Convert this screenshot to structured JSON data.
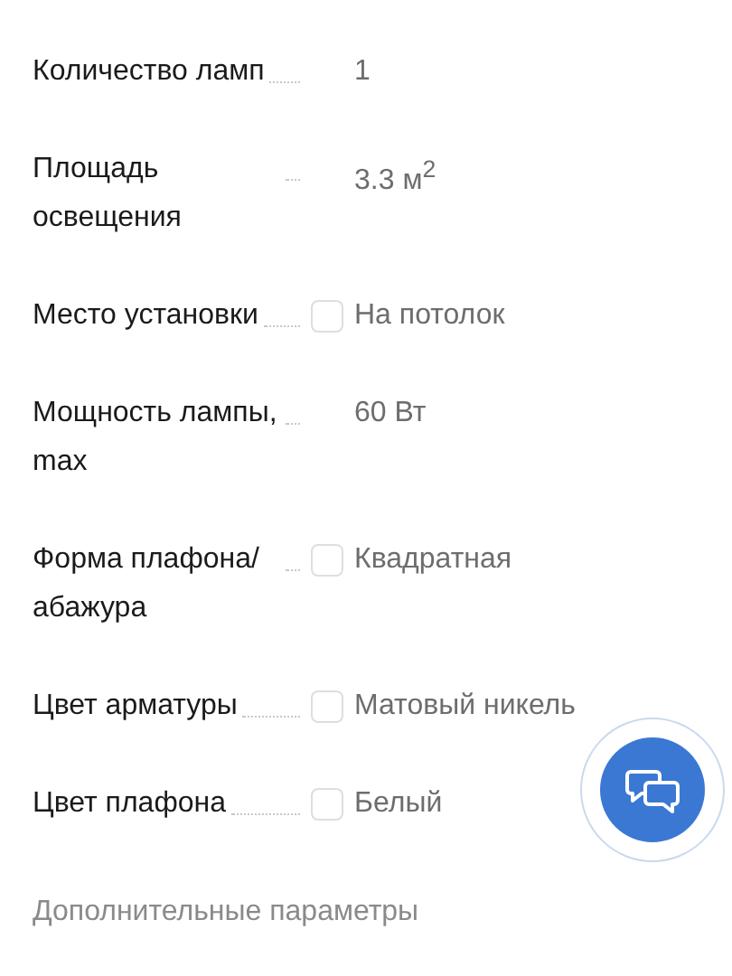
{
  "specs": [
    {
      "label": "Количество ламп",
      "value": "1",
      "kind": "plain"
    },
    {
      "label": "Площадь освещения",
      "value": "3.3 м$^{2}$",
      "kind": "plain"
    },
    {
      "label": "Место установки",
      "value": "На потолок",
      "kind": "checkbox",
      "checked": false
    },
    {
      "label": "Мощность лампы, max",
      "value": "60 Вт",
      "kind": "plain"
    },
    {
      "label": "Форма плафона/абажура",
      "value": "Квадратная",
      "kind": "checkbox",
      "checked": false
    },
    {
      "label": "Цвет арматуры",
      "value": "Матовый никель",
      "kind": "checkbox",
      "checked": false
    },
    {
      "label": "Цвет плафона",
      "value": "Белый",
      "kind": "checkbox",
      "checked": false
    }
  ],
  "section_heading": "Дополнительные параметры"
}
